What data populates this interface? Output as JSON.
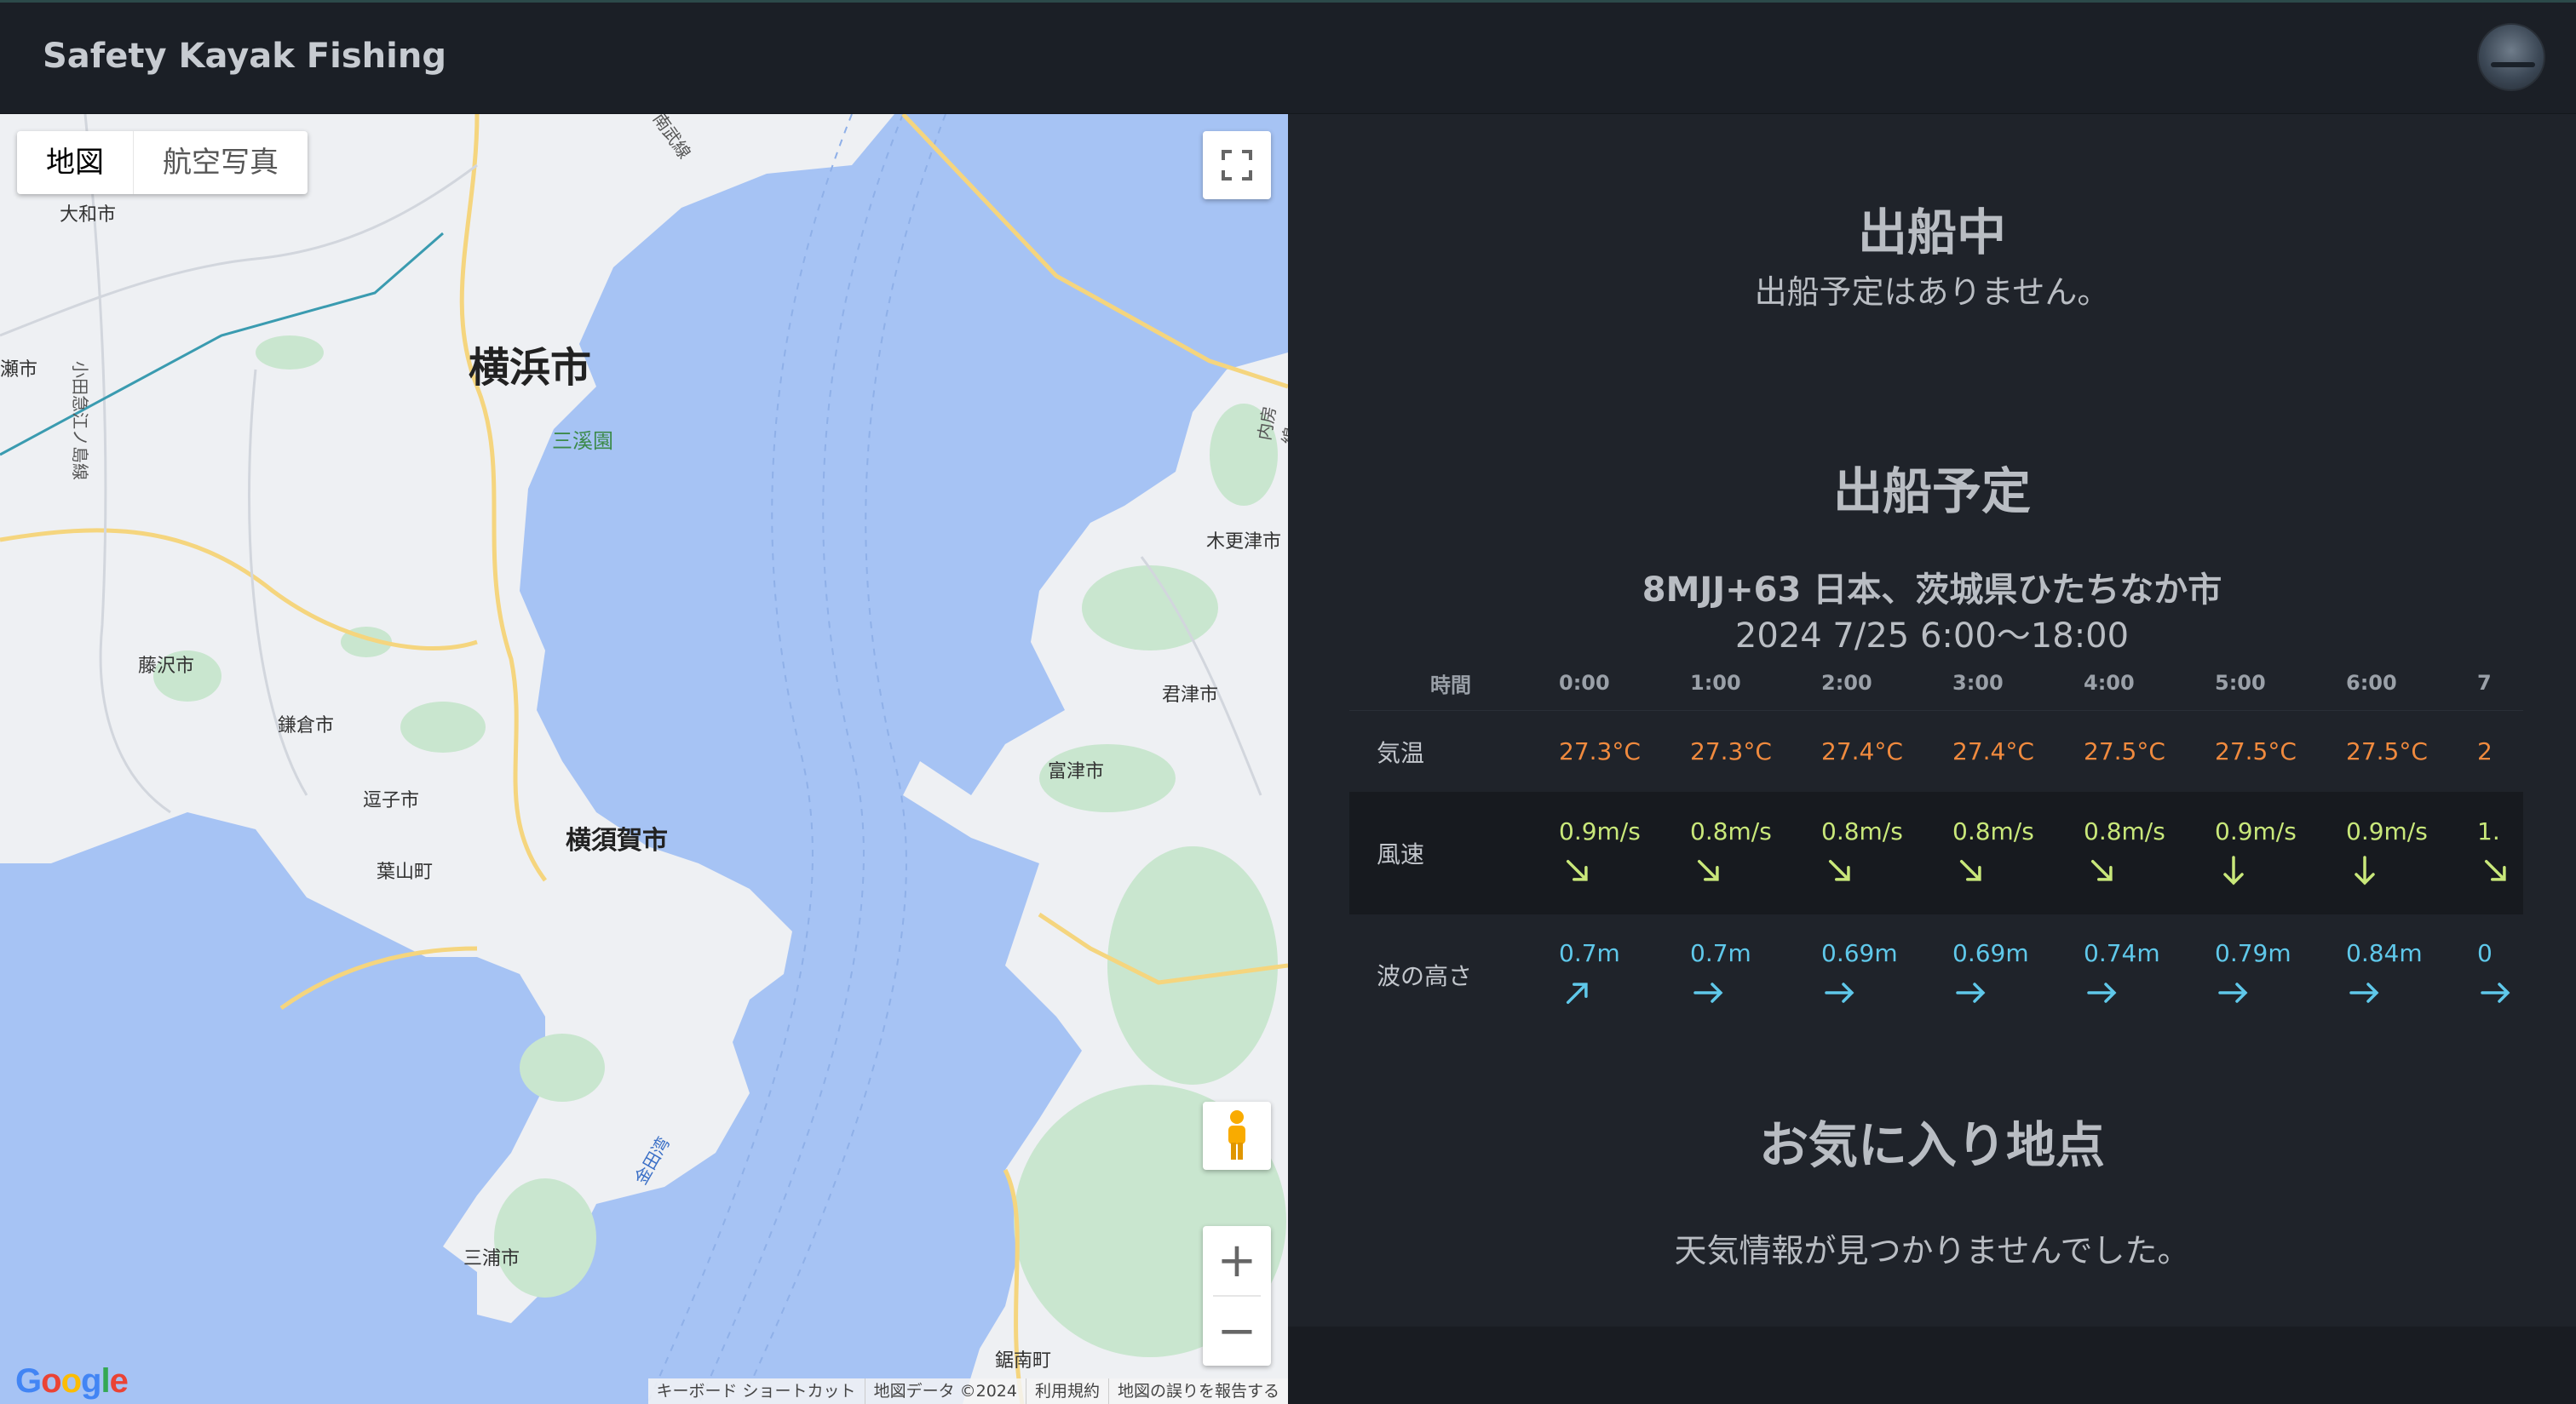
{
  "header": {
    "title": "Safety Kayak Fishing",
    "avatar": "user-avatar"
  },
  "map": {
    "type_buttons": [
      "地図",
      "航空写真"
    ],
    "labels": {
      "yokohama": "横浜市",
      "sankeien": "三溪園",
      "yamato": "大和市",
      "fujisawa": "藤沢市",
      "kamakura": "鎌倉市",
      "zushi": "逗子市",
      "hayama": "葉山町",
      "yokosuka": "横須賀市",
      "miura": "三浦市",
      "kisarazu": "木更津市",
      "kimitsu": "君津市",
      "futtsu": "富津市",
      "kyonan": "鋸南町",
      "kanadawan": "金田湾",
      "odakyu": "小田急江ノ島線",
      "nanbu": "南武線",
      "uchibo": "内房線",
      "ayase": "瀬市"
    },
    "attribution": [
      "キーボード ショートカット",
      "地図データ ©2024",
      "利用規約",
      "地図の誤りを報告する"
    ],
    "google": "Google"
  },
  "active": {
    "title": "出船中",
    "message": "出船予定はありません。"
  },
  "scheduled": {
    "title": "出船予定",
    "location": "8MJJ+63 日本、茨城県ひたちなか市",
    "time": "2024 7/25 6:00〜18:00",
    "forecast": {
      "row_labels": {
        "hour": "時間",
        "temp": "気温",
        "wind": "風速",
        "wave": "波の高さ"
      },
      "hours": [
        "0:00",
        "1:00",
        "2:00",
        "3:00",
        "4:00",
        "5:00",
        "6:00",
        "7"
      ],
      "temps": [
        "27.3°C",
        "27.3°C",
        "27.4°C",
        "27.4°C",
        "27.5°C",
        "27.5°C",
        "27.5°C",
        "2"
      ],
      "winds": [
        "0.9m/s",
        "0.8m/s",
        "0.8m/s",
        "0.8m/s",
        "0.8m/s",
        "0.9m/s",
        "0.9m/s",
        "1."
      ],
      "wind_dirs_deg": [
        135,
        135,
        135,
        135,
        135,
        180,
        180,
        135
      ],
      "waves": [
        "0.7m",
        "0.7m",
        "0.69m",
        "0.69m",
        "0.74m",
        "0.79m",
        "0.84m",
        "0"
      ],
      "wave_dirs_deg": [
        45,
        90,
        90,
        90,
        90,
        90,
        90,
        90
      ]
    }
  },
  "favorites": {
    "title": "お気に入り地点",
    "message": "天気情報が見つかりませんでした。"
  },
  "colors": {
    "temp": "#f08a3e",
    "wind": "#c9e87a",
    "wave": "#5fc8ea",
    "sea": "#a6c3f4",
    "land": "#eef0f3"
  }
}
